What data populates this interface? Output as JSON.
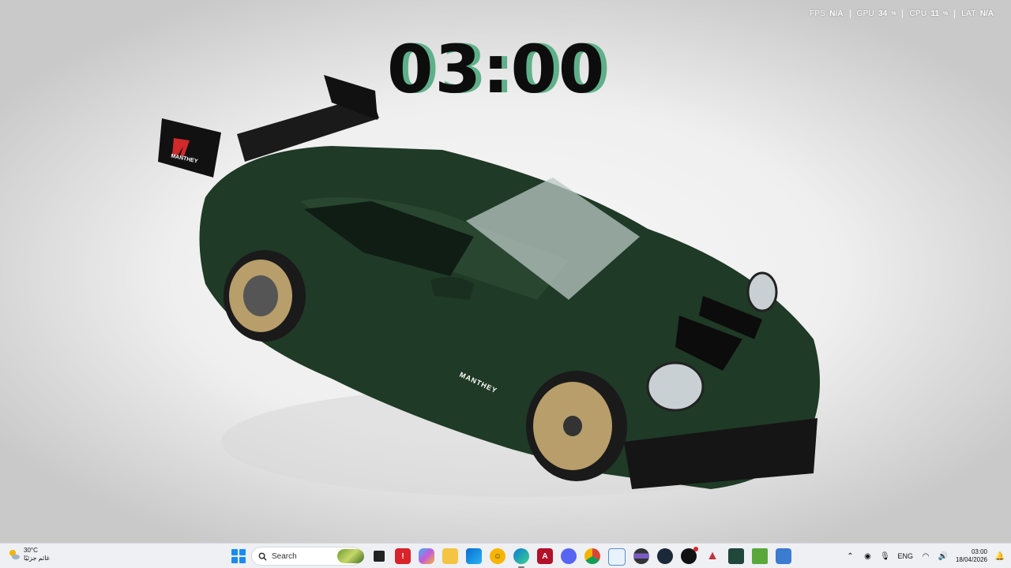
{
  "hud": {
    "fps_label": "FPS",
    "fps_value": "N/A",
    "gpu_label": "GPU",
    "gpu_value": "34",
    "cpu_label": "CPU",
    "cpu_value": "11",
    "lat_label": "LAT",
    "lat_value": "N/A"
  },
  "wallpaper": {
    "clock": "03:00",
    "brand_text": "MANTHEY",
    "car_color": "#1f3a26",
    "accent_color": "#5fb08a"
  },
  "taskbar": {
    "weather_temp": "30°C",
    "weather_desc": "غائم جزئيًا",
    "search_placeholder": "Search",
    "apps": [
      {
        "name": "file-explorer-dark",
        "icon": "terminal-icon"
      },
      {
        "name": "app-red",
        "icon": "app-icon"
      },
      {
        "name": "copilot",
        "icon": "copilot-icon"
      },
      {
        "name": "folder",
        "icon": "folder-icon"
      },
      {
        "name": "store",
        "icon": "store-icon"
      },
      {
        "name": "emoji-app",
        "icon": "emoji-icon"
      },
      {
        "name": "edge",
        "icon": "edge-icon"
      },
      {
        "name": "acrobat",
        "icon": "acrobat-icon"
      },
      {
        "name": "discord",
        "icon": "discord-icon"
      },
      {
        "name": "chrome",
        "icon": "chrome-icon"
      },
      {
        "name": "snip",
        "icon": "snip-icon"
      },
      {
        "name": "media",
        "icon": "media-icon"
      },
      {
        "name": "steam",
        "icon": "steam-icon"
      },
      {
        "name": "github",
        "icon": "github-icon"
      },
      {
        "name": "affinity",
        "icon": "affinity-icon"
      },
      {
        "name": "excel",
        "icon": "excel-icon"
      },
      {
        "name": "minecraft",
        "icon": "minecraft-icon"
      },
      {
        "name": "fox-app",
        "icon": "fox-icon"
      }
    ],
    "lang": "ENG",
    "time": "03:00",
    "date": "18/04/2026"
  }
}
